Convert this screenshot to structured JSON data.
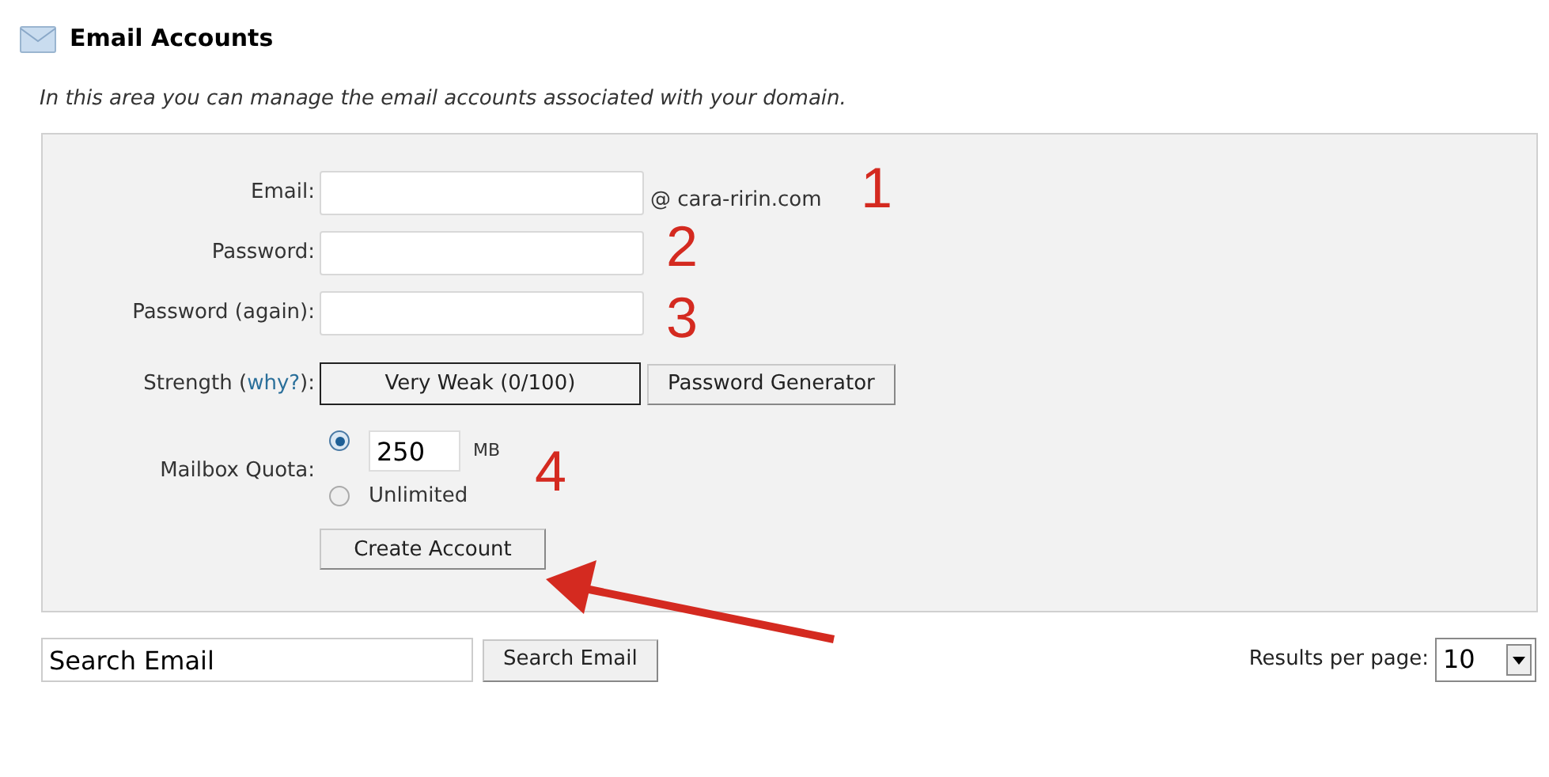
{
  "header": {
    "title": "Email Accounts"
  },
  "description": "In this area you can manage the email accounts associated with your domain.",
  "form": {
    "email_label": "Email:",
    "email_suffix": "@ cara-ririn.com",
    "password_label": "Password:",
    "password_again_label": "Password (again):",
    "strength_label": "Strength (",
    "strength_link": "why?",
    "strength_label_end": "):",
    "strength_value": "Very Weak (0/100)",
    "generator_button": "Password Generator",
    "quota_label": "Mailbox Quota:",
    "quota_options": [
      {
        "kind": "amount",
        "selected": true,
        "value": "250",
        "unit": "MB"
      },
      {
        "kind": "unlimited",
        "selected": false,
        "label": "Unlimited"
      }
    ],
    "create_button": "Create Account"
  },
  "annotations": [
    "1",
    "2",
    "3",
    "4"
  ],
  "search": {
    "value": "Search Email",
    "button": "Search Email"
  },
  "results": {
    "label": "Results per page:",
    "value": "10"
  }
}
